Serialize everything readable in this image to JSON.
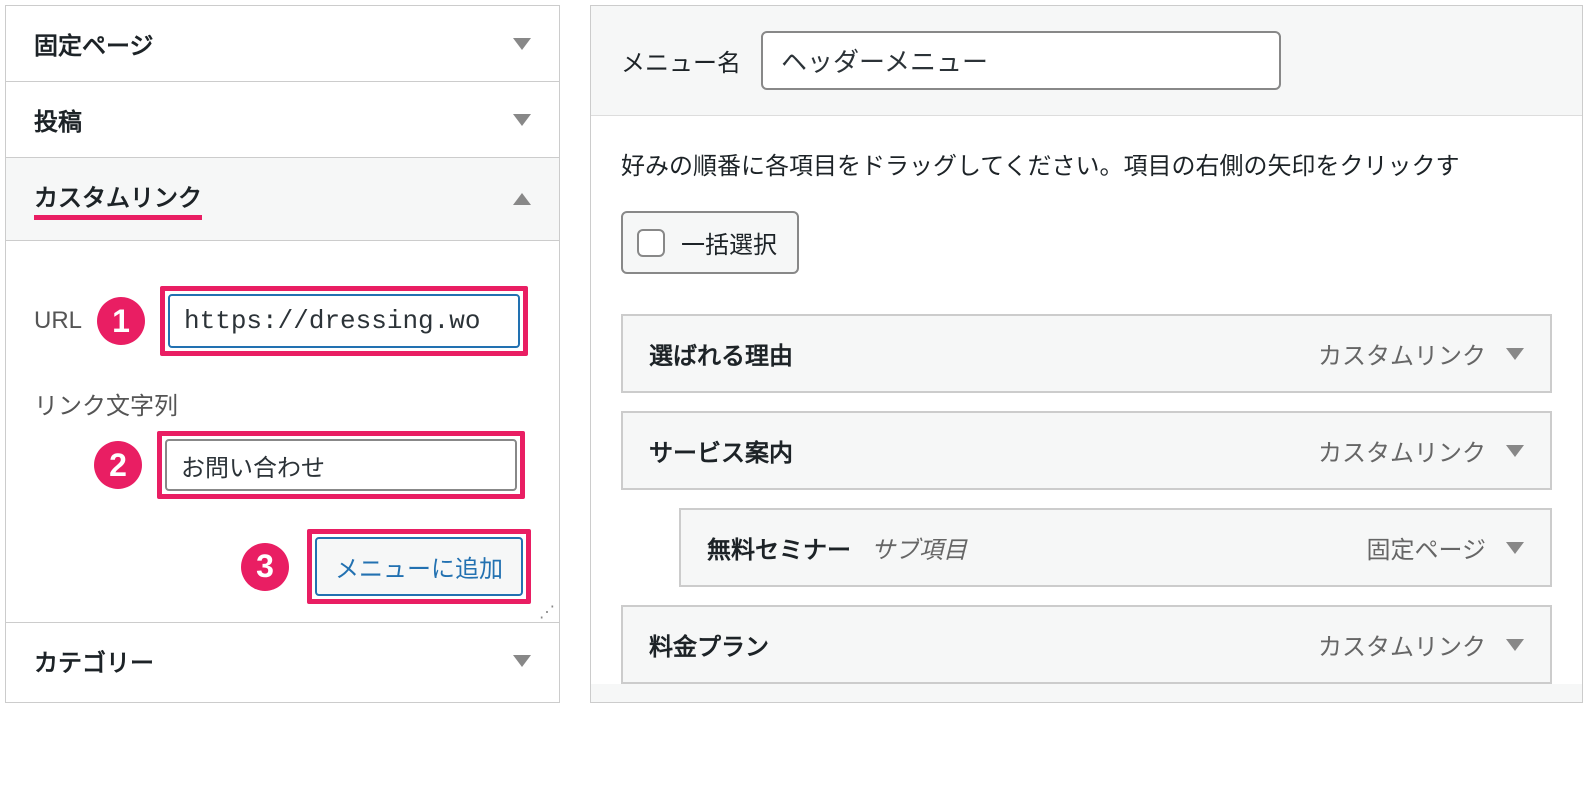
{
  "sidebar": {
    "pages_label": "固定ページ",
    "posts_label": "投稿",
    "custom_links_label": "カスタムリンク",
    "categories_label": "カテゴリー"
  },
  "custom_link_form": {
    "url_label": "URL",
    "url_value": "https://dressing.wo",
    "link_text_label": "リンク文字列",
    "link_text_value": "お問い合わせ",
    "add_button_label": "メニューに追加"
  },
  "badges": {
    "b1": "1",
    "b2": "2",
    "b3": "3"
  },
  "menu": {
    "name_label": "メニュー名",
    "name_value": "ヘッダーメニュー",
    "instruction": "好みの順番に各項目をドラッグしてください。項目の右側の矢印をクリックす",
    "select_all_label": "一括選択"
  },
  "menu_items": [
    {
      "title": "選ばれる理由",
      "type": "カスタムリンク",
      "sub": false
    },
    {
      "title": "サービス案内",
      "type": "カスタムリンク",
      "sub": false
    },
    {
      "title": "無料セミナー",
      "type": "固定ページ",
      "sub": true,
      "sub_label": "サブ項目"
    },
    {
      "title": "料金プラン",
      "type": "カスタムリンク",
      "sub": false
    }
  ]
}
